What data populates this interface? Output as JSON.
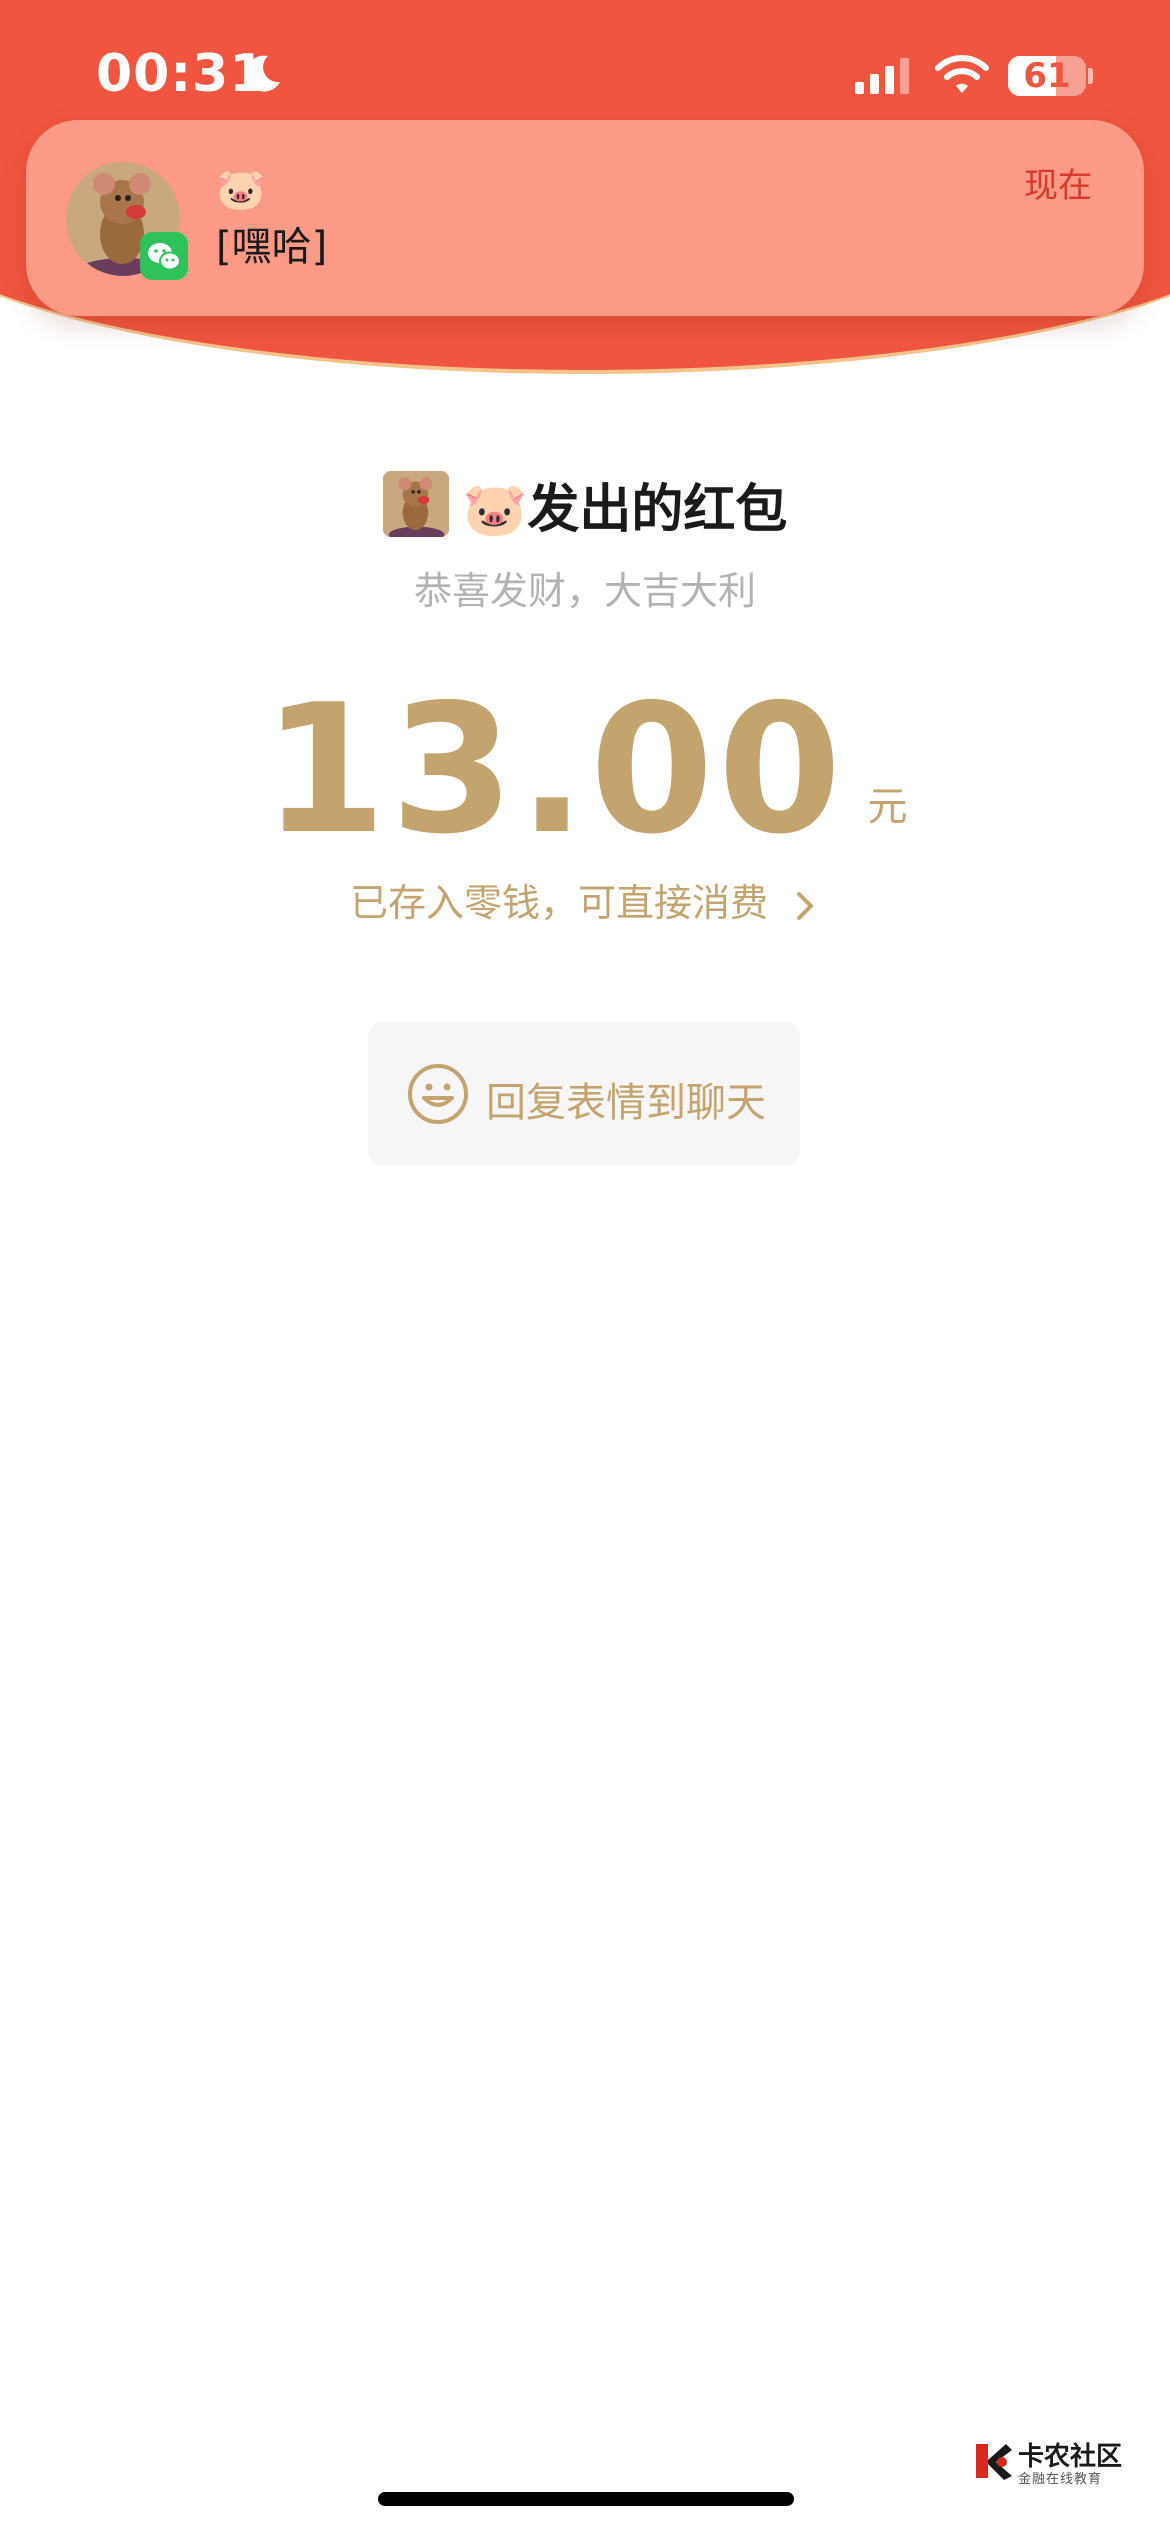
{
  "status_bar": {
    "time": "00:31",
    "battery_level": 61,
    "battery_text": "61",
    "icons": [
      "moon-icon",
      "signal-icon",
      "wifi-icon",
      "battery-icon"
    ]
  },
  "notification": {
    "sender": "🐷",
    "message": "[嘿哈]",
    "time": "现在",
    "app_badge_icon": "wechat-icon"
  },
  "red_packet": {
    "sender_emoji": "🐷",
    "title": "发出的红包",
    "greeting": "恭喜发财，大吉大利",
    "amount": "13.00",
    "unit": "元",
    "deposit_text": "已存入零钱，可直接消费",
    "reply_label": "回复表情到聊天"
  },
  "watermark": {
    "name": "卡农社区",
    "subtitle": "金融在线教育"
  },
  "colors": {
    "header_red": "#f0553f",
    "notification_bg": "#fb9a86",
    "gold": "#c3a46f",
    "wechat_green": "#2fc25b"
  }
}
